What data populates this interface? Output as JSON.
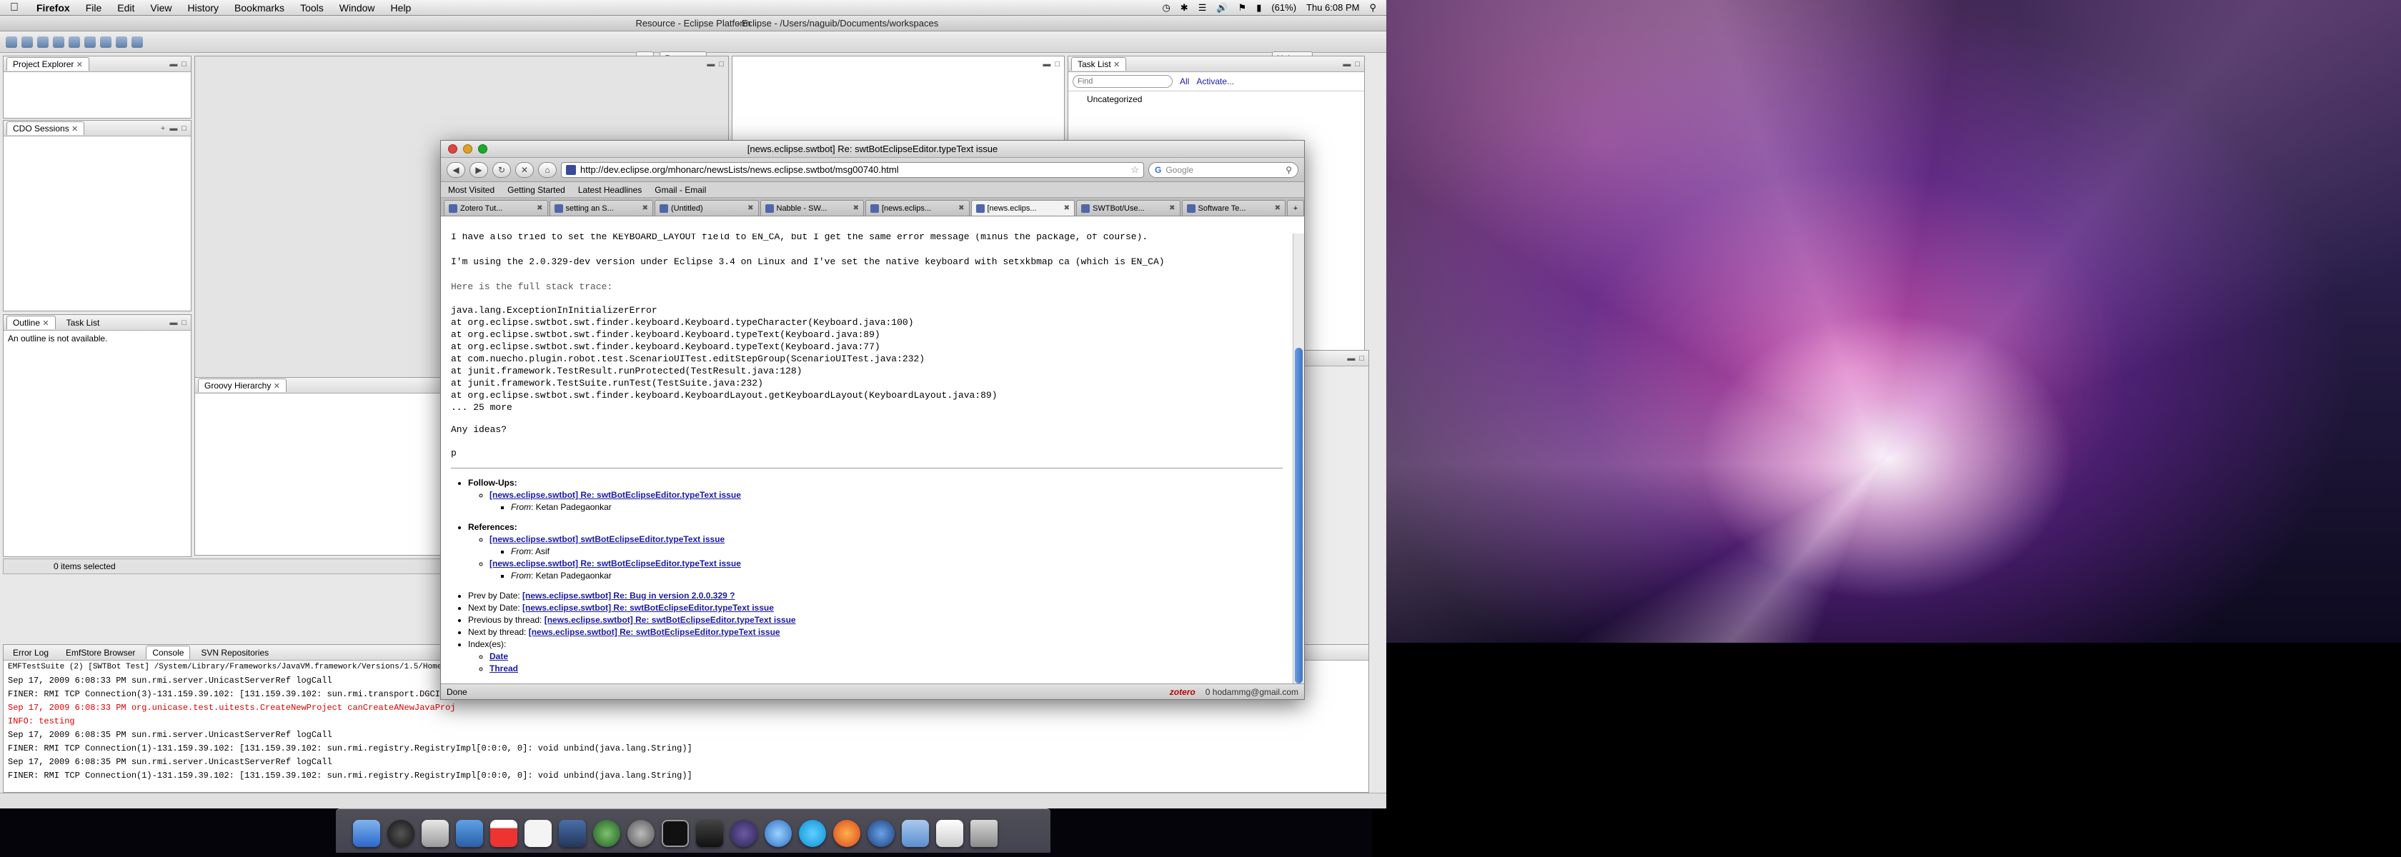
{
  "menubar": {
    "app": "Firefox",
    "items": [
      "File",
      "Edit",
      "View",
      "History",
      "Bookmarks",
      "Tools",
      "Window",
      "Help"
    ],
    "battery": "(61%)",
    "clock": "Thu 6:08 PM"
  },
  "eclipse": {
    "title": "Resource - Eclipse Platform",
    "title_right": "- Eclipse - /Users/naguib/Documents/workspaces",
    "perspective": "Resource",
    "perspective_right": "Unicase",
    "project_explorer_tab": "Project Explorer",
    "cdo_sessions_tab": "CDO Sessions",
    "outline_tab": "Outline",
    "task_list_tab_small": "Task List",
    "outline_message": "An outline is not available.",
    "groovy_tab": "Groovy Hierarchy",
    "task_list_tab": "Task List",
    "find_placeholder": "Find",
    "all_label": "All",
    "activate_label": "Activate...",
    "uncategorized": "Uncategorized",
    "items_selected": "0 items selected",
    "bottom_tabs": [
      "Error Log",
      "EmfStore Browser",
      "Console",
      "SVN Repositories"
    ],
    "console_header": "EMFTestSuite (2) [SWTBot Test] /System/Library/Frameworks/JavaVM.framework/Versions/1.5/Home/bin/java (Se",
    "console_lines": [
      {
        "text": "Sep 17, 2009 6:08:33 PM sun.rmi.server.UnicastServerRef logCall",
        "err": false
      },
      {
        "text": "FINER: RMI TCP Connection(3)-131.159.39.102: [131.159.39.102: sun.rmi.transport.DGCImp",
        "err": false
      },
      {
        "text": "Sep 17, 2009 6:08:33 PM org.unicase.test.uitests.CreateNewProject canCreateANewJavaProj",
        "err": true
      },
      {
        "text": "INFO: testing",
        "err": true
      },
      {
        "text": "Sep 17, 2009 6:08:35 PM sun.rmi.server.UnicastServerRef logCall",
        "err": false
      },
      {
        "text": "FINER: RMI TCP Connection(1)-131.159.39.102: [131.159.39.102: sun.rmi.registry.RegistryImpl[0:0:0, 0]: void unbind(java.lang.String)]",
        "err": false
      },
      {
        "text": "Sep 17, 2009 6:08:35 PM sun.rmi.server.UnicastServerRef logCall",
        "err": false
      },
      {
        "text": "FINER: RMI TCP Connection(1)-131.159.39.102: [131.159.39.102: sun.rmi.registry.RegistryImpl[0:0:0, 0]: void unbind(java.lang.String)]",
        "err": false
      }
    ]
  },
  "firefox": {
    "title": "[news.eclipse.swtbot] Re: swtBotEclipseEditor.typeText issue",
    "url": "http://dev.eclipse.org/mhonarc/newsLists/news.eclipse.swtbot/msg00740.html",
    "search_placeholder": "Google",
    "bookmarks": [
      "Most Visited",
      "Getting Started",
      "Latest Headlines",
      "Gmail - Email"
    ],
    "tabs": [
      {
        "label": "Zotero Tut...",
        "active": false
      },
      {
        "label": "setting an S...",
        "active": false
      },
      {
        "label": "(Untitled)",
        "active": false
      },
      {
        "label": "Nabble - SW...",
        "active": false
      },
      {
        "label": "[news.eclips...",
        "active": false
      },
      {
        "label": "[news.eclips...",
        "active": true
      },
      {
        "label": "SWTBot/Use...",
        "active": false
      },
      {
        "label": "Software Te...",
        "active": false
      }
    ],
    "status_left": "Done",
    "status_zotero": "zotero",
    "status_email": "0 hodammg@gmail.com",
    "message": {
      "line1": "I have also tried to set the KEYBOARD_LAYOUT field to EN_CA, but I get the same error message (minus the package, of course).",
      "line2": "I'm using the 2.0.329-dev version under Eclipse 3.4 on Linux and I've set the native keyboard with setxkbmap ca (which is EN_CA)",
      "stack_intro": "Here is the full stack trace:",
      "stack": [
        "java.lang.ExceptionInInitializerError",
        "at org.eclipse.swtbot.swt.finder.keyboard.Keyboard.typeCharacter(Keyboard.java:100)",
        "at org.eclipse.swtbot.swt.finder.keyboard.Keyboard.typeText(Keyboard.java:89)",
        "at org.eclipse.swtbot.swt.finder.keyboard.Keyboard.typeText(Keyboard.java:77)",
        "at com.nuecho.plugin.robot.test.ScenarioUITest.editStepGroup(ScenarioUITest.java:232)",
        "at junit.framework.TestResult.runProtected(TestResult.java:128)",
        "at junit.framework.TestSuite.runTest(TestSuite.java:232)",
        "at org.eclipse.swtbot.swt.finder.keyboard.KeyboardLayout.getKeyboardLayout(KeyboardLayout.java:89)",
        "... 25 more"
      ],
      "question": "Any ideas?",
      "sign": "p"
    },
    "followups_label": "Follow-Ups",
    "followups": [
      {
        "link": "[news.eclipse.swtbot] Re: swtBotEclipseEditor.typeText issue",
        "from": "Ketan Padegaonkar"
      }
    ],
    "references_label": "References",
    "references": [
      {
        "link": "[news.eclipse.swtbot] swtBotEclipseEditor.typeText issue",
        "from": "Asif"
      },
      {
        "link": "[news.eclipse.swtbot] Re: swtBotEclipseEditor.typeText issue",
        "from": "Ketan Padegaonkar"
      }
    ],
    "from_label": "From",
    "nav": [
      {
        "label": "Prev by Date:",
        "link": "[news.eclipse.swtbot] Re: Bug in version 2.0.0.329 ?"
      },
      {
        "label": "Next by Date:",
        "link": "[news.eclipse.swtbot] Re: swtBotEclipseEditor.typeText issue"
      },
      {
        "label": "Previous by thread:",
        "link": "[news.eclipse.swtbot] Re: swtBotEclipseEditor.typeText issue"
      },
      {
        "label": "Next by thread:",
        "link": "[news.eclipse.swtbot] Re: swtBotEclipseEditor.typeText issue"
      }
    ],
    "index_label": "Index(es):",
    "index_links": [
      "Date",
      "Thread"
    ]
  },
  "colors": {
    "link": "#1a1aa6",
    "error_text": "#dd0000",
    "scroll_thumb": "#3c73c7"
  }
}
